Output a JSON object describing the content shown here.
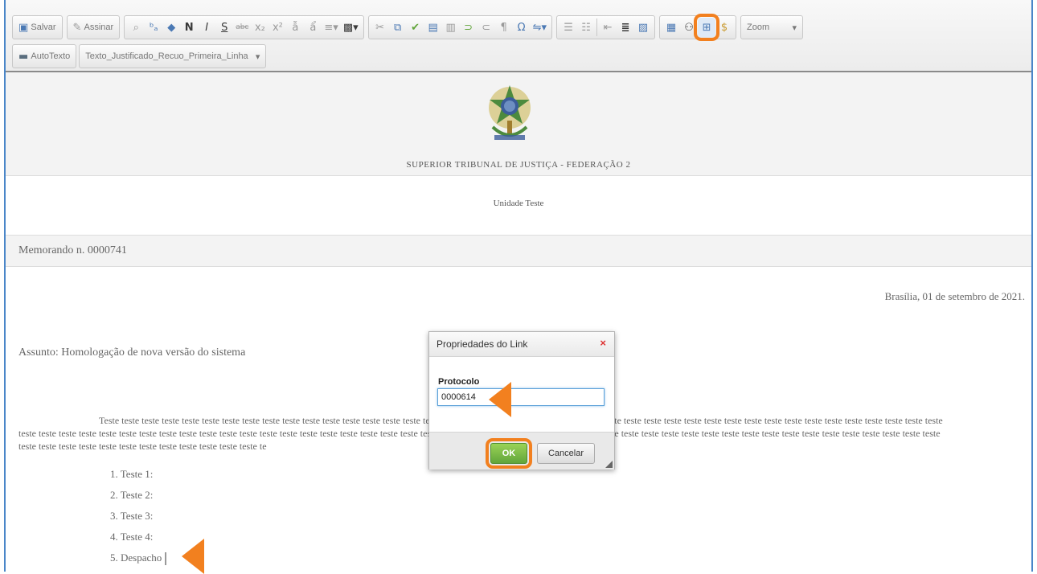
{
  "toolbar": {
    "save_label": "Salvar",
    "sign_label": "Assinar",
    "bold_label": "N",
    "italic_label": "I",
    "strike_label": "S",
    "omega_label": "Ω",
    "dollar_label": "$",
    "zoom_label": "Zoom",
    "autotext_label": "AutoTexto",
    "style_value": "Texto_Justificado_Recuo_Primeira_Linha"
  },
  "document": {
    "court": "SUPERIOR TRIBUNAL DE JUSTIÇA - FEDERAÇÃO 2",
    "unit": "Unidade Teste",
    "memo": "Memorando n. 0000741",
    "date": "Brasília, 01 de setembro de 2021.",
    "subject": "Assunto: Homologação de nova versão do sistema",
    "paragraph_lines": [
      "Teste teste teste teste teste teste teste teste teste teste teste teste teste teste teste teste teste teste teste teste teste teste teste teste teste teste teste teste teste teste teste teste teste teste teste teste teste teste teste teste teste teste",
      "teste teste teste teste teste teste teste teste teste teste teste teste teste teste teste teste teste teste teste teste teste teste teste teste teste teste teste teste teste teste teste teste teste teste teste teste teste teste teste teste teste teste teste teste teste teste",
      "teste teste teste teste teste teste teste teste teste teste teste teste te"
    ],
    "list": [
      "1. Teste 1:",
      "2. Teste 2:",
      "3. Teste 3:",
      "4. Teste 4:",
      "5. Despacho"
    ]
  },
  "dialog": {
    "title": "Propriedades do Link",
    "close": "×",
    "field_label": "Protocolo",
    "field_value": "0000614",
    "ok_label": "OK",
    "cancel_label": "Cancelar"
  },
  "colors": {
    "highlight": "#f2801f",
    "ok_green": "#62a53b",
    "frame_blue": "#4a86c8"
  }
}
